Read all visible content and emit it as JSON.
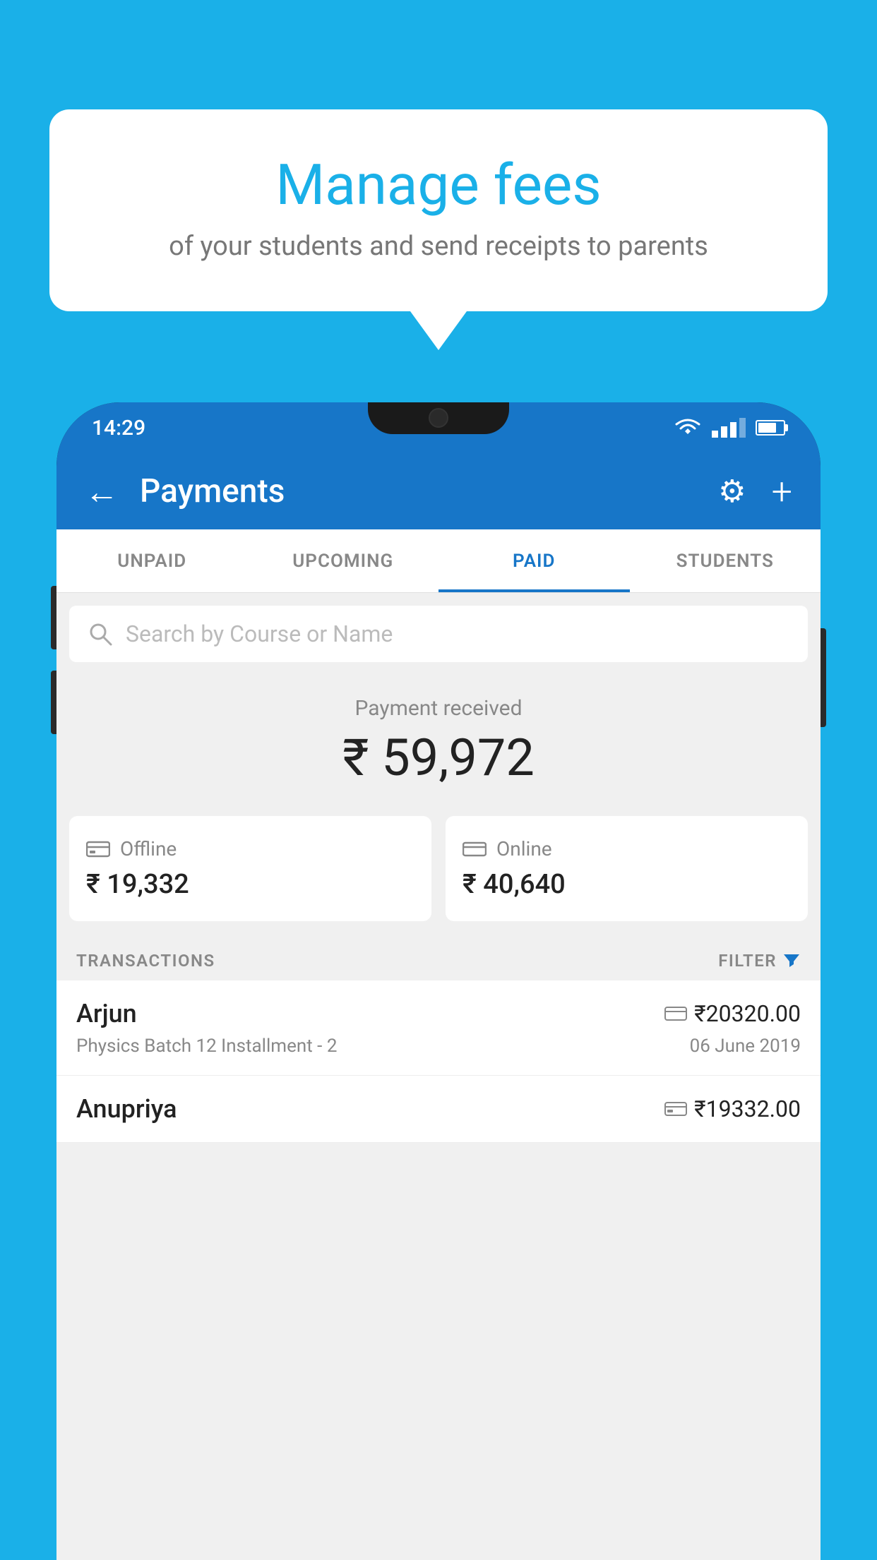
{
  "background_color": "#1ab0e8",
  "speech_bubble": {
    "title": "Manage fees",
    "subtitle": "of your students and send receipts to parents"
  },
  "status_bar": {
    "time": "14:29",
    "wifi": true,
    "signal": true,
    "battery": true
  },
  "app_header": {
    "title": "Payments",
    "back_icon": "←",
    "gear_icon": "⚙",
    "plus_icon": "+"
  },
  "tabs": [
    {
      "label": "UNPAID",
      "active": false
    },
    {
      "label": "UPCOMING",
      "active": false
    },
    {
      "label": "PAID",
      "active": true
    },
    {
      "label": "STUDENTS",
      "active": false
    }
  ],
  "search": {
    "placeholder": "Search by Course or Name"
  },
  "payment_received": {
    "label": "Payment received",
    "amount": "₹ 59,972"
  },
  "payment_cards": [
    {
      "type": "Offline",
      "amount": "₹ 19,332",
      "icon": "💳"
    },
    {
      "type": "Online",
      "amount": "₹ 40,640",
      "icon": "💳"
    }
  ],
  "transactions_section": {
    "label": "TRANSACTIONS",
    "filter_label": "FILTER"
  },
  "transactions": [
    {
      "name": "Arjun",
      "detail": "Physics Batch 12 Installment - 2",
      "amount": "₹20320.00",
      "date": "06 June 2019",
      "payment_type": "online"
    },
    {
      "name": "Anupriya",
      "detail": "",
      "amount": "₹19332.00",
      "date": "",
      "payment_type": "offline"
    }
  ]
}
